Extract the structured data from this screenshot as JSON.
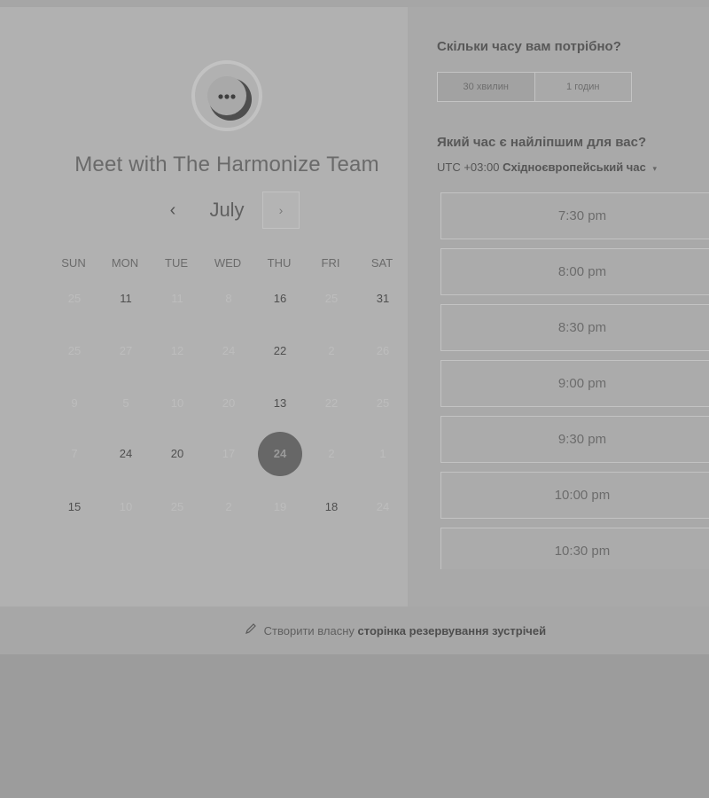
{
  "scheduler": {
    "title": "Meet with The Harmonize Team",
    "avatar_icon": "chat-bubble-icon",
    "month": "July",
    "prev_symbol": "‹",
    "next_symbol": "›",
    "weekdays": [
      "SUN",
      "MON",
      "TUE",
      "WED",
      "THU",
      "FRI",
      "SAT"
    ],
    "weeks": [
      [
        {
          "d": "25",
          "a": false
        },
        {
          "d": "11",
          "a": true
        },
        {
          "d": "11",
          "a": false
        },
        {
          "d": "8",
          "a": false
        },
        {
          "d": "16",
          "a": true
        },
        {
          "d": "25",
          "a": false
        },
        {
          "d": "31",
          "a": true
        }
      ],
      [
        {
          "d": "25",
          "a": false
        },
        {
          "d": "27",
          "a": false
        },
        {
          "d": "12",
          "a": false
        },
        {
          "d": "24",
          "a": false
        },
        {
          "d": "22",
          "a": true
        },
        {
          "d": "2",
          "a": false
        },
        {
          "d": "26",
          "a": false
        }
      ],
      [
        {
          "d": "9",
          "a": false
        },
        {
          "d": "5",
          "a": false
        },
        {
          "d": "10",
          "a": false
        },
        {
          "d": "20",
          "a": false
        },
        {
          "d": "13",
          "a": true
        },
        {
          "d": "22",
          "a": false
        },
        {
          "d": "25",
          "a": false
        }
      ],
      [
        {
          "d": "7",
          "a": false
        },
        {
          "d": "24",
          "a": true
        },
        {
          "d": "20",
          "a": true
        },
        {
          "d": "17",
          "a": false
        },
        {
          "d": "24",
          "a": true,
          "sel": true
        },
        {
          "d": "2",
          "a": false
        },
        {
          "d": "1",
          "a": false
        }
      ],
      [
        {
          "d": "15",
          "a": true
        },
        {
          "d": "10",
          "a": false
        },
        {
          "d": "25",
          "a": false
        },
        {
          "d": "2",
          "a": false
        },
        {
          "d": "19",
          "a": false
        },
        {
          "d": "18",
          "a": true
        },
        {
          "d": "24",
          "a": false
        }
      ]
    ]
  },
  "booking": {
    "duration_question": "Скільки часу вам потрібно?",
    "durations": [
      "30 хвилин",
      "1 годин"
    ],
    "selected_duration": "30 хвилин",
    "time_question": "Який час є найліпшим для вас?",
    "timezone_offset": "UTC +03:00",
    "timezone_name": "Східноєвропейський час",
    "timezone_caret": "▾",
    "slots": [
      "7:30 pm",
      "8:00 pm",
      "8:30 pm",
      "9:00 pm",
      "9:30 pm",
      "10:00 pm",
      "10:30 pm"
    ]
  },
  "footer": {
    "icon": "pencil-icon",
    "prefix": "Створити власну",
    "link": "сторінка резервування зустрічей"
  }
}
